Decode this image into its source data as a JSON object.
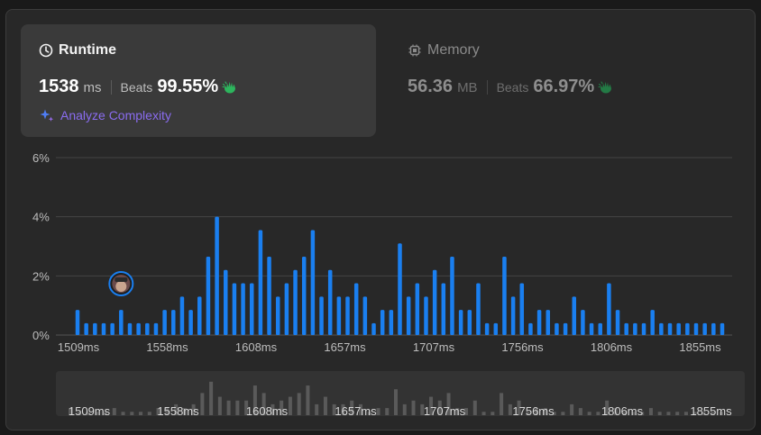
{
  "runtime": {
    "title": "Runtime",
    "value": "1538",
    "unit": "ms",
    "beats_label": "Beats",
    "beats_value": "99.55%",
    "analyze_label": "Analyze Complexity"
  },
  "memory": {
    "title": "Memory",
    "value": "56.36",
    "unit": "MB",
    "beats_label": "Beats",
    "beats_value": "66.97%"
  },
  "colors": {
    "bar": "#1a7ff0",
    "bar_nav": "#5a5a5a",
    "accent_purple": "#8a6cf0",
    "beats_hand": "#2db55d"
  },
  "chart_data": {
    "type": "bar",
    "ylabel_ticks": [
      "0%",
      "2%",
      "4%",
      "6%"
    ],
    "ylim": [
      0,
      6
    ],
    "x_tick_labels": [
      "1509ms",
      "1558ms",
      "1608ms",
      "1657ms",
      "1707ms",
      "1756ms",
      "1806ms",
      "1855ms"
    ],
    "grid": true,
    "values": [
      0.85,
      0.4,
      0.4,
      0.4,
      0.4,
      0.85,
      0.4,
      0.4,
      0.4,
      0.4,
      0.85,
      0.85,
      1.3,
      0.85,
      1.3,
      2.65,
      4.0,
      2.2,
      1.75,
      1.75,
      1.75,
      3.55,
      2.65,
      1.3,
      1.75,
      2.2,
      2.65,
      3.55,
      1.3,
      2.2,
      1.3,
      1.3,
      1.75,
      1.3,
      0.4,
      0.85,
      0.85,
      3.1,
      1.3,
      1.75,
      1.3,
      2.2,
      1.75,
      2.65,
      0.85,
      0.85,
      1.75,
      0.4,
      0.4,
      2.65,
      1.3,
      1.75,
      0.4,
      0.85,
      0.85,
      0.4,
      0.4,
      1.3,
      0.85,
      0.4,
      0.4,
      1.75,
      0.85,
      0.4,
      0.4,
      0.4,
      0.85,
      0.4,
      0.4,
      0.4,
      0.4,
      0.4,
      0.4,
      0.4,
      0.4
    ],
    "highlight_index": 5
  }
}
